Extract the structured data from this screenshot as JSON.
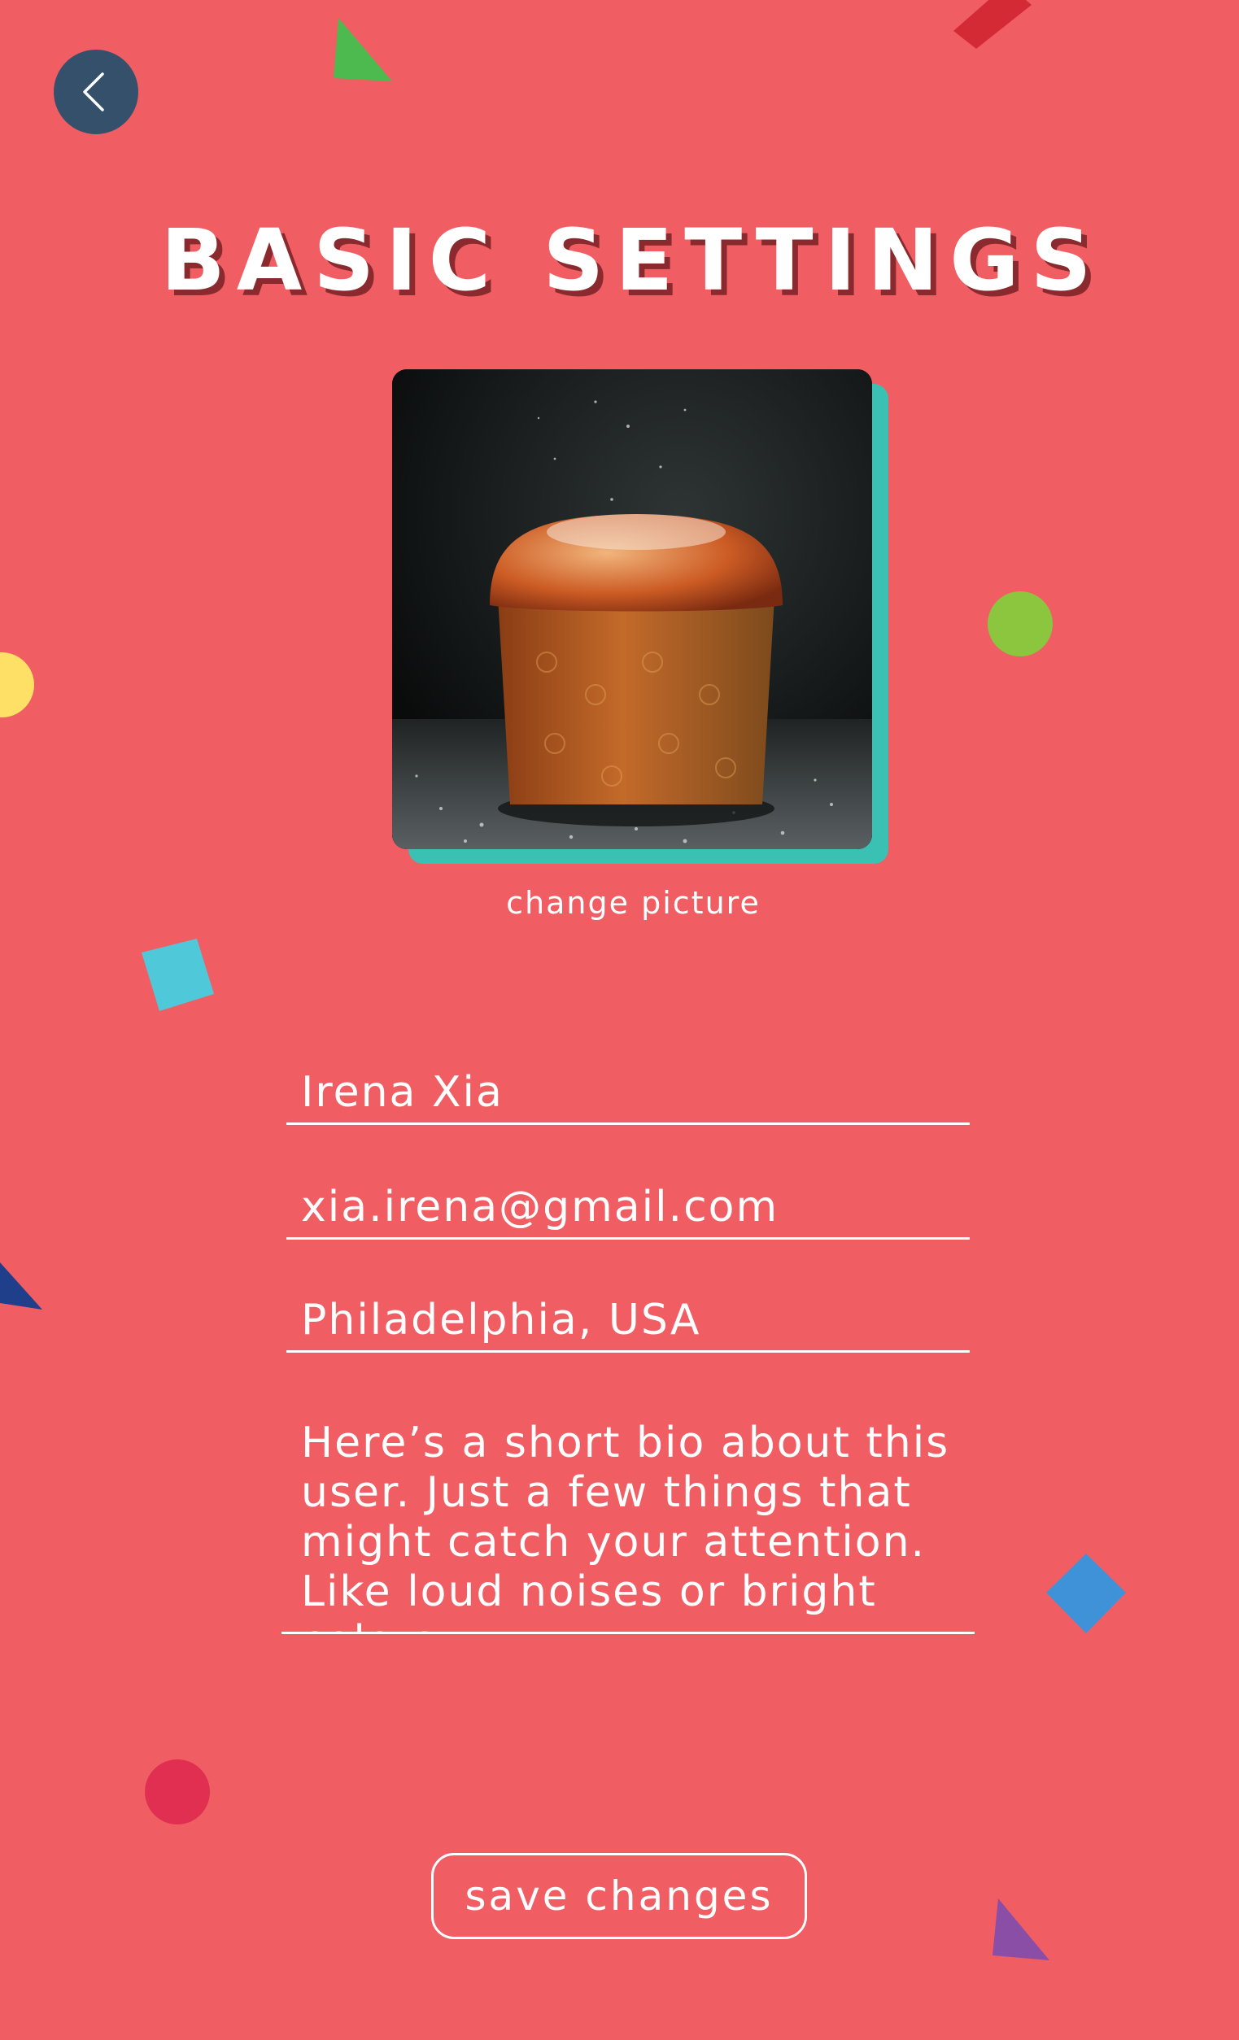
{
  "header": {
    "title": "BASIC SETTINGS",
    "back_icon": "chevron-left-icon"
  },
  "profile": {
    "avatar_image": "muffin-photo",
    "change_picture_label": "change picture"
  },
  "form": {
    "name": "Irena Xia",
    "email": "xia.irena@gmail.com",
    "location": "Philadelphia, USA",
    "bio": "Here’s a short bio about this user. Just a few things that might catch your attention. Like loud noises or bright colors."
  },
  "actions": {
    "save_label": "save changes"
  },
  "colors": {
    "background": "#f05e63",
    "back_button": "#34506b",
    "avatar_accent": "#3ac1b3",
    "text": "#ffffff"
  }
}
